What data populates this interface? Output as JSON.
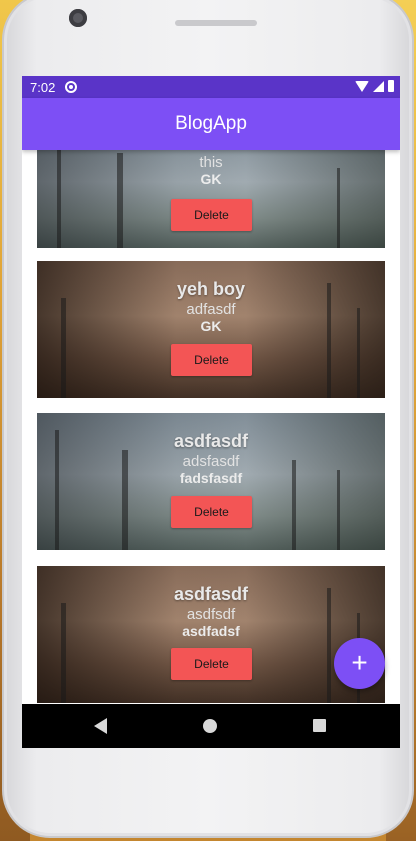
{
  "statusbar": {
    "time": "7:02"
  },
  "appbar": {
    "title": "BlogApp"
  },
  "posts": [
    {
      "title": "",
      "body": "this",
      "author": "GK",
      "delete_label": "Delete"
    },
    {
      "title": "yeh boy",
      "body": "adfasdf",
      "author": "GK",
      "delete_label": "Delete"
    },
    {
      "title": "asdfasdf",
      "body": "adsfasdf",
      "author": "fadsfasdf",
      "delete_label": "Delete"
    },
    {
      "title": "asdfasdf",
      "body": "asdfsdf",
      "author": "asdfadsf",
      "delete_label": "Delete"
    }
  ],
  "fab": {
    "label": "+"
  },
  "colors": {
    "primary": "#7d4ff5",
    "status_bar": "#5a34c8",
    "delete_button": "#f35555"
  },
  "icons": {
    "status": [
      "sync-icon",
      "wifi-icon",
      "signal-icon",
      "battery-icon"
    ],
    "nav": [
      "back-icon",
      "home-icon",
      "recents-icon"
    ]
  }
}
